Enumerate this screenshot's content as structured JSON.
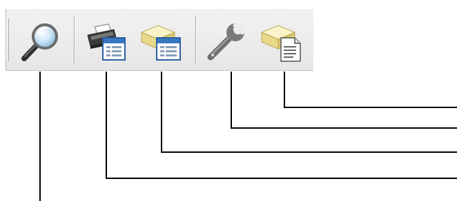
{
  "toolbar": {
    "buttons": [
      {
        "id": "search",
        "label": "Search",
        "icon": "magnifier-icon"
      },
      {
        "id": "print-preview",
        "label": "Print Preview",
        "icon": "printer-window-icon"
      },
      {
        "id": "db-window",
        "label": "Database Window",
        "icon": "database-window-icon"
      },
      {
        "id": "tools",
        "label": "Tools",
        "icon": "wrench-icon"
      },
      {
        "id": "db-report",
        "label": "Database Report",
        "icon": "database-document-icon"
      }
    ]
  },
  "colors": {
    "toolbar_bg": "#ececec",
    "callout_line": "#000000",
    "icon_blue": "#3a78c2",
    "database_cream": "#f3e7a8",
    "wrench_gray": "#7a7a7a"
  }
}
